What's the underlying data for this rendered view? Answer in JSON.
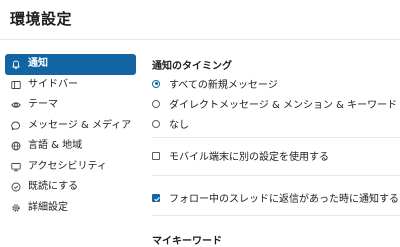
{
  "window": {
    "title": "環境設定"
  },
  "sidebar": {
    "items": [
      {
        "label": "通知",
        "icon": "bell-icon",
        "active": true
      },
      {
        "label": "サイドバー",
        "icon": "sidebar-icon",
        "active": false
      },
      {
        "label": "テーマ",
        "icon": "eye-icon",
        "active": false
      },
      {
        "label": "メッセージ & メディア",
        "icon": "message-icon",
        "active": false
      },
      {
        "label": "言語 & 地域",
        "icon": "globe-icon",
        "active": false
      },
      {
        "label": "アクセシビリティ",
        "icon": "monitor-icon",
        "active": false
      },
      {
        "label": "既読にする",
        "icon": "check-circle-icon",
        "active": false
      },
      {
        "label": "詳細設定",
        "icon": "gear-icon",
        "active": false
      }
    ]
  },
  "notifications": {
    "timing_title": "通知のタイミング",
    "options": [
      {
        "label": "すべての新規メッセージ",
        "selected": true
      },
      {
        "label": "ダイレクトメッセージ & メンション & キーワード",
        "selected": false
      },
      {
        "label": "なし",
        "selected": false
      }
    ],
    "mobile_setting": {
      "label": "モバイル端末に別の設定を使用する",
      "checked": false
    },
    "thread_setting": {
      "label": "フォロー中のスレッドに返信があった時に通知する",
      "checked": true
    },
    "keywords_title": "マイキーワード"
  },
  "colors": {
    "accent": "#1264a3",
    "text": "#1d1c1d",
    "divider": "#e8e8e8"
  }
}
